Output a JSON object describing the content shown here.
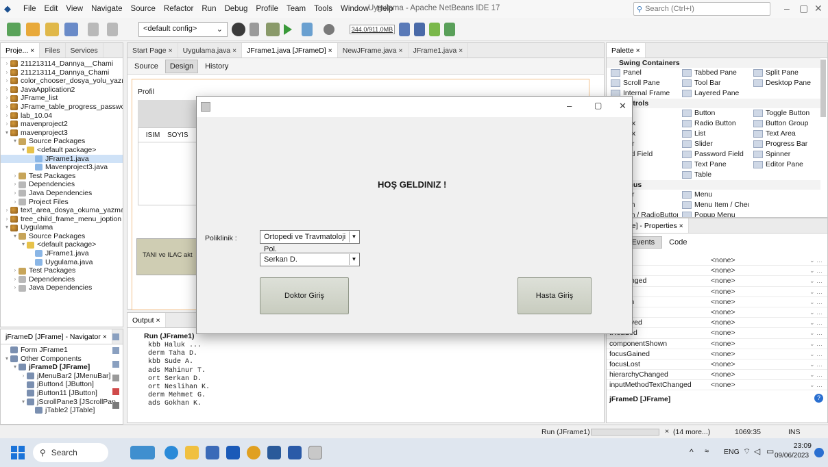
{
  "menubar": {
    "items": [
      "File",
      "Edit",
      "View",
      "Navigate",
      "Source",
      "Refactor",
      "Run",
      "Debug",
      "Profile",
      "Team",
      "Tools",
      "Window",
      "Help"
    ],
    "window_title": "Uygulama - Apache NetBeans IDE 17",
    "search_placeholder": "Search (Ctrl+I)"
  },
  "toolbar": {
    "config": "<default config>",
    "memory": "344.0/911.0MB"
  },
  "projects": {
    "tabs": [
      "Proje...",
      "Files",
      "Services"
    ],
    "tree": [
      {
        "t": "211213114_Dannya__Chami",
        "i": "proj",
        "d": 0,
        "a": ">"
      },
      {
        "t": "211213114_Dannya_Chami",
        "i": "proj",
        "d": 0,
        "a": ">"
      },
      {
        "t": "color_chooser_dosya_yolu_yazı",
        "i": "proj",
        "d": 0,
        "a": ">"
      },
      {
        "t": "JavaApplication2",
        "i": "proj",
        "d": 0,
        "a": ">"
      },
      {
        "t": "JFrame_list",
        "i": "proj",
        "d": 0,
        "a": ">"
      },
      {
        "t": "JFrame_table_progress_passwc",
        "i": "proj",
        "d": 0,
        "a": ">"
      },
      {
        "t": "lab_10.04",
        "i": "proj",
        "d": 0,
        "a": ">"
      },
      {
        "t": "mavenproject2",
        "i": "proj",
        "d": 0,
        "a": ">"
      },
      {
        "t": "mavenproject3",
        "i": "proj",
        "d": 0,
        "a": "v"
      },
      {
        "t": "Source Packages",
        "i": "folder",
        "d": 1,
        "a": "v"
      },
      {
        "t": "<default package>",
        "i": "pkg",
        "d": 2,
        "a": "v"
      },
      {
        "t": "JFrame1.java",
        "i": "java",
        "d": 3,
        "a": "",
        "sel": true
      },
      {
        "t": "Mavenproject3.java",
        "i": "java",
        "d": 3,
        "a": ""
      },
      {
        "t": "Test Packages",
        "i": "folder",
        "d": 1,
        "a": ">"
      },
      {
        "t": "Dependencies",
        "i": "lib",
        "d": 1,
        "a": ">"
      },
      {
        "t": "Java Dependencies",
        "i": "lib",
        "d": 1,
        "a": ">"
      },
      {
        "t": "Project Files",
        "i": "lib",
        "d": 1,
        "a": ">"
      },
      {
        "t": "text_area_dosya_okuma_yazma",
        "i": "proj",
        "d": 0,
        "a": ">"
      },
      {
        "t": "tree_child_frame_menu_joption",
        "i": "proj",
        "d": 0,
        "a": ">"
      },
      {
        "t": "Uygulama",
        "i": "proj",
        "d": 0,
        "a": "v"
      },
      {
        "t": "Source Packages",
        "i": "folder",
        "d": 1,
        "a": "v"
      },
      {
        "t": "<default package>",
        "i": "pkg",
        "d": 2,
        "a": "v"
      },
      {
        "t": "JFrame1.java",
        "i": "java",
        "d": 3,
        "a": ""
      },
      {
        "t": "Uygulama.java",
        "i": "java",
        "d": 3,
        "a": ""
      },
      {
        "t": "Test Packages",
        "i": "folder",
        "d": 1,
        "a": ">"
      },
      {
        "t": "Dependencies",
        "i": "lib",
        "d": 1,
        "a": ">"
      },
      {
        "t": "Java Dependencies",
        "i": "lib",
        "d": 1,
        "a": ">"
      }
    ]
  },
  "editor": {
    "tabs": [
      "Start Page",
      "Uygulama.java",
      "JFrame1.java [JFrameD]",
      "NewJFrame.java",
      "JFrame1.java"
    ],
    "views": [
      "Source",
      "Design",
      "History"
    ],
    "form_title": "Profil",
    "col1": "ISIM",
    "col2": "SOYIS",
    "side_button": "TANI ve ILAC akt"
  },
  "palette": {
    "title": "Palette",
    "containers_header": "Swing Containers",
    "containers": [
      [
        "Panel",
        "Tabbed Pane",
        "Split Pane"
      ],
      [
        "Scroll Pane",
        "Tool Bar",
        "Desktop Pane"
      ],
      [
        "Internal Frame",
        "Layered Pane",
        ""
      ]
    ],
    "controls_header": "Controls",
    "controls": [
      [
        "",
        "Button",
        "Toggle Button"
      ],
      [
        "Box",
        "Radio Button",
        "Button Group"
      ],
      [
        "Box",
        "List",
        "Text Area"
      ],
      [
        "Bar",
        "Slider",
        "Progress Bar"
      ],
      [
        "tted Field",
        "Password Field",
        "Spinner"
      ],
      [
        "tor",
        "Text Pane",
        "Editor Pane"
      ],
      [
        "",
        "Table",
        ""
      ]
    ],
    "menus_header": "Menus",
    "menus": [
      [
        "Bar",
        "Menu",
        ""
      ],
      [
        "tem",
        "Menu Item / CheckBox",
        ""
      ],
      [
        "tem / RadioButton",
        "Popup Menu",
        ""
      ]
    ]
  },
  "properties": {
    "title": "JFrame] - Properties",
    "tabs": [
      "s",
      "Events",
      "Code"
    ],
    "rows": [
      [
        "oved",
        "<none>"
      ],
      [
        "esized",
        "<none>"
      ],
      [
        "onChanged",
        "<none>"
      ],
      [
        "tAdded",
        "<none>"
      ],
      [
        "tHidden",
        "<none>"
      ],
      [
        "tMoved",
        "<none>"
      ],
      [
        "tRemoved",
        "<none>"
      ],
      [
        "tResized",
        "<none>"
      ],
      [
        "componentShown",
        "<none>"
      ],
      [
        "focusGained",
        "<none>"
      ],
      [
        "focusLost",
        "<none>"
      ],
      [
        "hierarchyChanged",
        "<none>"
      ],
      [
        "inputMethodTextChanged",
        "<none>"
      ]
    ],
    "footer": "jFrameD [JFrame]"
  },
  "navigator": {
    "title": "jFrameD [JFrame] - Navigator",
    "tree": [
      {
        "t": "Form JFrame1",
        "d": 0,
        "a": ""
      },
      {
        "t": "Other Components",
        "d": 0,
        "a": "v"
      },
      {
        "t": "jFrameD [JFrame]",
        "d": 1,
        "a": "v",
        "bold": true
      },
      {
        "t": "jMenuBar2 [JMenuBar]",
        "d": 2,
        "a": ">"
      },
      {
        "t": "jButton4 [JButton]",
        "d": 2,
        "a": ""
      },
      {
        "t": "jButton11 [JButton]",
        "d": 2,
        "a": ""
      },
      {
        "t": "jScrollPane3 [JScrollPan",
        "d": 2,
        "a": "v"
      },
      {
        "t": "jTable2 [JTable]",
        "d": 3,
        "a": ""
      }
    ]
  },
  "output": {
    "tab": "Output",
    "run_title": "Run (JFrame1)",
    "lines": [
      "kbb Haluk ...",
      "derm Taha D.",
      "kbb Sude A.",
      "ads Mahinur T.",
      "ort Serkan D.",
      "ort Neslihan K.",
      "derm Mehmet G.",
      "ads Gokhan K."
    ]
  },
  "status": {
    "run": "Run (JFrame1)",
    "more": "(14 more...)",
    "position": "1069:35",
    "mode": "INS"
  },
  "taskbar": {
    "search": "Search",
    "lang": "ENG",
    "time": "23:09",
    "date": "09/06/2023"
  },
  "dialog": {
    "heading": "HOŞ GELDINIZ !",
    "poliklinik_label": "Poliklinik :",
    "poliklinik_value": "Ortopedi ve Travmatoloji Pol.",
    "doctor_value": "Serkan D.",
    "doctor_button": "Doktor Giriş",
    "patient_button": "Hasta Giriş"
  }
}
